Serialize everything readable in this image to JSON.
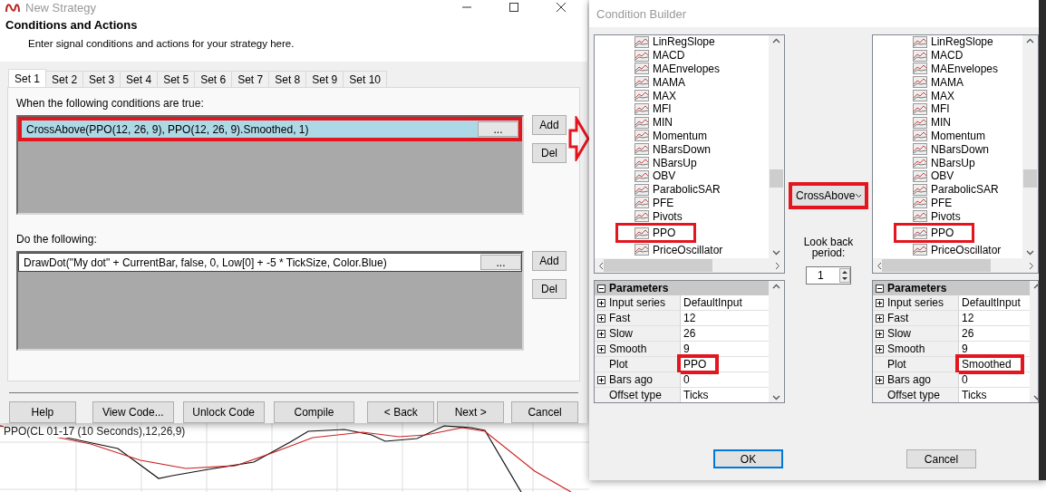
{
  "strategy_window": {
    "title": "New Strategy",
    "heading": "Conditions and Actions",
    "subheading": "Enter signal conditions and actions for your strategy here.",
    "tabs": [
      {
        "label": "Set 1",
        "selected": true
      },
      {
        "label": "Set 2",
        "selected": false
      },
      {
        "label": "Set 3",
        "selected": false
      },
      {
        "label": "Set 4",
        "selected": false
      },
      {
        "label": "Set 5",
        "selected": false
      },
      {
        "label": "Set 6",
        "selected": false
      },
      {
        "label": "Set 7",
        "selected": false
      },
      {
        "label": "Set 8",
        "selected": false
      },
      {
        "label": "Set 9",
        "selected": false
      },
      {
        "label": "Set 10",
        "selected": false
      }
    ],
    "sections": [
      {
        "label": "When the following conditions are true:",
        "items": [
          {
            "text": "CrossAbove(PPO(12, 26, 9), PPO(12, 26, 9).Smoothed, 1)",
            "browse": "...",
            "selected": true,
            "highlighted": true
          }
        ],
        "buttons": [
          "Add",
          "Del"
        ]
      },
      {
        "label": "Do the following:",
        "items": [
          {
            "text": "DrawDot(\"My dot\" + CurrentBar, false, 0, Low[0] + -5 * TickSize, Color.Blue)",
            "browse": "...",
            "selected": false,
            "highlighted": false
          }
        ],
        "buttons": [
          "Add",
          "Del"
        ]
      }
    ],
    "footer_buttons": [
      "Help",
      "View Code...",
      "Unlock Code",
      "Compile",
      "< Back",
      "Next >",
      "Cancel"
    ]
  },
  "chart": {
    "label": "PPO(CL 01-17 (10 Seconds),12,26,9)"
  },
  "condition_builder": {
    "title": "Condition Builder",
    "operands": [
      {
        "indicators": [
          {
            "name": "LinRegSlope",
            "highlighted": false
          },
          {
            "name": "MACD",
            "highlighted": false
          },
          {
            "name": "MAEnvelopes",
            "highlighted": false
          },
          {
            "name": "MAMA",
            "highlighted": false
          },
          {
            "name": "MAX",
            "highlighted": false
          },
          {
            "name": "MFI",
            "highlighted": false
          },
          {
            "name": "MIN",
            "highlighted": false
          },
          {
            "name": "Momentum",
            "highlighted": false
          },
          {
            "name": "NBarsDown",
            "highlighted": false
          },
          {
            "name": "NBarsUp",
            "highlighted": false
          },
          {
            "name": "OBV",
            "highlighted": false
          },
          {
            "name": "ParabolicSAR",
            "highlighted": false
          },
          {
            "name": "PFE",
            "highlighted": false
          },
          {
            "name": "Pivots",
            "highlighted": false
          },
          {
            "name": "PPO",
            "highlighted": true
          },
          {
            "name": "PriceOscillator",
            "highlighted": false
          }
        ],
        "parameters": {
          "title": "Parameters",
          "expanded": true,
          "rows": [
            {
              "name": "Input series",
              "value": "DefaultInput",
              "expandable": true,
              "highlighted": false
            },
            {
              "name": "Fast",
              "value": "12",
              "expandable": true,
              "highlighted": false
            },
            {
              "name": "Slow",
              "value": "26",
              "expandable": true,
              "highlighted": false
            },
            {
              "name": "Smooth",
              "value": "9",
              "expandable": true,
              "highlighted": false
            },
            {
              "name": "Plot",
              "value": "PPO",
              "expandable": false,
              "highlighted": true
            },
            {
              "name": "Bars ago",
              "value": "0",
              "expandable": true,
              "highlighted": false
            },
            {
              "name": "Offset type",
              "value": "Ticks",
              "expandable": false,
              "highlighted": false
            }
          ]
        }
      },
      {
        "indicators": [
          {
            "name": "LinRegSlope",
            "highlighted": false
          },
          {
            "name": "MACD",
            "highlighted": false
          },
          {
            "name": "MAEnvelopes",
            "highlighted": false
          },
          {
            "name": "MAMA",
            "highlighted": false
          },
          {
            "name": "MAX",
            "highlighted": false
          },
          {
            "name": "MFI",
            "highlighted": false
          },
          {
            "name": "MIN",
            "highlighted": false
          },
          {
            "name": "Momentum",
            "highlighted": false
          },
          {
            "name": "NBarsDown",
            "highlighted": false
          },
          {
            "name": "NBarsUp",
            "highlighted": false
          },
          {
            "name": "OBV",
            "highlighted": false
          },
          {
            "name": "ParabolicSAR",
            "highlighted": false
          },
          {
            "name": "PFE",
            "highlighted": false
          },
          {
            "name": "Pivots",
            "highlighted": false
          },
          {
            "name": "PPO",
            "highlighted": true
          },
          {
            "name": "PriceOscillator",
            "highlighted": false
          }
        ],
        "parameters": {
          "title": "Parameters",
          "expanded": true,
          "rows": [
            {
              "name": "Input series",
              "value": "DefaultInput",
              "expandable": true,
              "highlighted": false
            },
            {
              "name": "Fast",
              "value": "12",
              "expandable": true,
              "highlighted": false
            },
            {
              "name": "Slow",
              "value": "26",
              "expandable": true,
              "highlighted": false
            },
            {
              "name": "Smooth",
              "value": "9",
              "expandable": true,
              "highlighted": false
            },
            {
              "name": "Plot",
              "value": "Smoothed",
              "expandable": false,
              "highlighted": true
            },
            {
              "name": "Bars ago",
              "value": "0",
              "expandable": true,
              "highlighted": false
            },
            {
              "name": "Offset type",
              "value": "Ticks",
              "expandable": false,
              "highlighted": false
            }
          ]
        }
      }
    ],
    "operator": {
      "value": "CrossAbove",
      "highlighted": true
    },
    "lookback": {
      "label": "Look back period:",
      "value": "1"
    },
    "buttons": [
      "OK",
      "Cancel"
    ]
  }
}
